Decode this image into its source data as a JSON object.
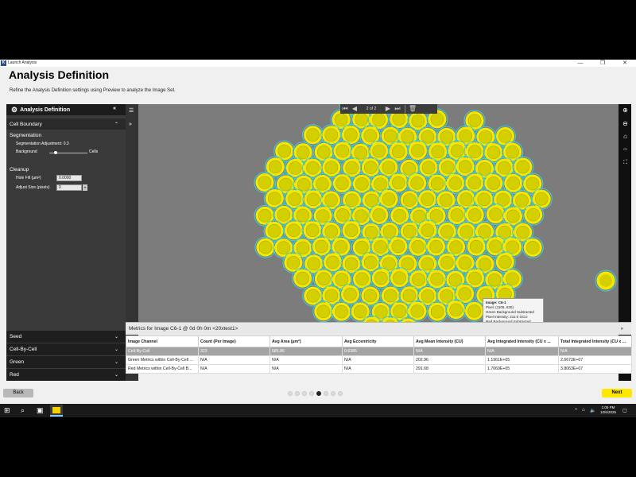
{
  "window": {
    "app_icon_letter": "K",
    "title": "Launch Analysis",
    "minimize": "—",
    "maximize": "❐",
    "close": "✕"
  },
  "page": {
    "title": "Analysis Definition",
    "subtitle": "Refine the Analysis Definition settings using Preview to analyze the Image Set."
  },
  "left_panel": {
    "header": "Analysis Definition",
    "header_collapse": "«",
    "cell_boundary": "Cell Boundary",
    "segmentation_title": "Segmentation",
    "segmentation_adjustment": "Segmentation Adjustment:  0.3",
    "background_label": "Background",
    "cells_label": "Cells",
    "cleanup_title": "Cleanup",
    "hole_fill_label": "Hole Fill (µm²)",
    "hole_fill_value": "0.0000",
    "adjust_size_label": "Adjust Size (pixels)",
    "adjust_size_value": "0",
    "bottom_items": [
      "Seed",
      "Cell-By-Cell",
      "Green",
      "Red"
    ]
  },
  "viewer": {
    "page_indicator": "2  of  2"
  },
  "tooltip": {
    "line1": "Image: C6-1",
    "line2": "Pixel: (1105, 630)",
    "line3": "Green Background Subtracted",
    "line4": "Pixel Intensity: 211.0 GCU",
    "line5": "Red Background Subtracted",
    "line6": "Pixel Intensity: 362.0 RCU"
  },
  "metrics": {
    "title": "Metrics for Image C6-1 @ 0d 0h 0m <20xtest1>",
    "toggle": "»",
    "columns": [
      "Image Channel",
      "Count (Per Image)",
      "Avg Area (µm²)",
      "Avg Eccentricity",
      "Avg Mean Intensity (CU)",
      "Avg Integrated Intensity (CU x ...",
      "Total Integrated Intensity (CU x ..."
    ],
    "rows": [
      [
        "Cell-By-Cell",
        "323",
        "585.86",
        "0.6385",
        "N/A",
        "N/A",
        "N/A"
      ],
      [
        "Green Metrics within Cell-By-Cell ...",
        "N/A",
        "N/A",
        "N/A",
        "202.96",
        "1.1961E+05",
        "2.6672E+07"
      ],
      [
        "Red Metrics within Cell-By-Cell B...",
        "N/A",
        "N/A",
        "N/A",
        "291.68",
        "1.7069E+05",
        "3.8063E+07"
      ]
    ]
  },
  "footer": {
    "back": "Back",
    "next": "Next",
    "dot_count": 8,
    "active_dot": 4
  },
  "taskbar": {
    "time": "1:05 PM",
    "date": "10/6/2025"
  },
  "colors": {
    "cell_fill": "#d4d000",
    "cell_ring": "#f5e800",
    "cell_outline": "#36d0e0",
    "next_button": "#ffe800"
  }
}
